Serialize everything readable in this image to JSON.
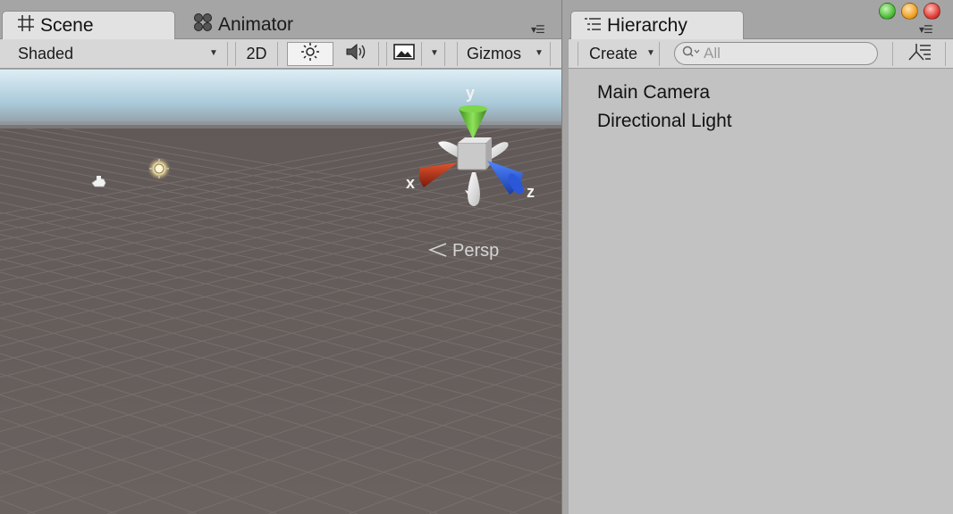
{
  "scene_panel": {
    "tabs": [
      {
        "label": "Scene",
        "icon": "grid-icon",
        "active": true
      },
      {
        "label": "Animator",
        "icon": "animator-icon",
        "active": false
      }
    ],
    "toolbar": {
      "shading_mode": "Shaded",
      "mode_2d_label": "2D",
      "lighting_icon": "sun-icon",
      "audio_icon": "speaker-icon",
      "effects_icon": "image-icon",
      "gizmos_label": "Gizmos"
    },
    "gizmo": {
      "x_label": "x",
      "y_label": "y",
      "z_label": "z",
      "projection_label": "Persp",
      "colors": {
        "x": "#c83a1e",
        "y": "#6cc23a",
        "z": "#2c5fe6"
      }
    },
    "viewport_colors": {
      "sky_top": "#dcedf4",
      "sky_bottom": "#a5c6d8",
      "ground": "#675f5d",
      "grid": "#7a7370"
    }
  },
  "hierarchy_panel": {
    "tab_label": "Hierarchy",
    "tab_icon": "list-icon",
    "create_label": "Create",
    "search_placeholder": "All",
    "items": [
      "Main Camera",
      "Directional Light"
    ]
  },
  "window_controls": {
    "colors": [
      "#4fbf3c",
      "#f0a32b",
      "#e2403a"
    ]
  }
}
